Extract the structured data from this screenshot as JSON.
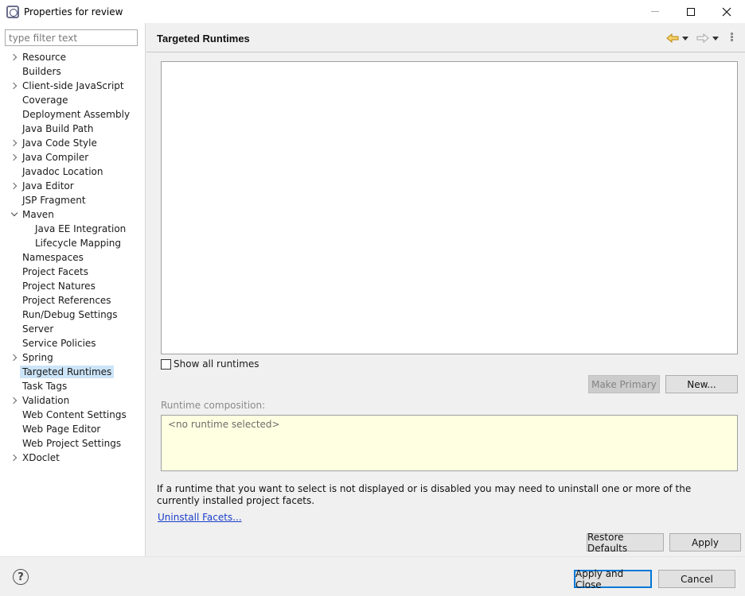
{
  "window": {
    "title": "Properties for review",
    "app_icon": "eclipse-icon"
  },
  "filter": {
    "placeholder": "type filter text",
    "value": ""
  },
  "tree": [
    {
      "label": "Resource",
      "expander": "collapsed",
      "level": 0
    },
    {
      "label": "Builders",
      "expander": "none",
      "level": 0
    },
    {
      "label": "Client-side JavaScript",
      "expander": "collapsed",
      "level": 0
    },
    {
      "label": "Coverage",
      "expander": "none",
      "level": 0
    },
    {
      "label": "Deployment Assembly",
      "expander": "none",
      "level": 0
    },
    {
      "label": "Java Build Path",
      "expander": "none",
      "level": 0
    },
    {
      "label": "Java Code Style",
      "expander": "collapsed",
      "level": 0
    },
    {
      "label": "Java Compiler",
      "expander": "collapsed",
      "level": 0
    },
    {
      "label": "Javadoc Location",
      "expander": "none",
      "level": 0
    },
    {
      "label": "Java Editor",
      "expander": "collapsed",
      "level": 0
    },
    {
      "label": "JSP Fragment",
      "expander": "none",
      "level": 0
    },
    {
      "label": "Maven",
      "expander": "expanded",
      "level": 0
    },
    {
      "label": "Java EE Integration",
      "expander": "none",
      "level": 1
    },
    {
      "label": "Lifecycle Mapping",
      "expander": "none",
      "level": 1
    },
    {
      "label": "Namespaces",
      "expander": "none",
      "level": 0
    },
    {
      "label": "Project Facets",
      "expander": "none",
      "level": 0
    },
    {
      "label": "Project Natures",
      "expander": "none",
      "level": 0
    },
    {
      "label": "Project References",
      "expander": "none",
      "level": 0
    },
    {
      "label": "Run/Debug Settings",
      "expander": "none",
      "level": 0
    },
    {
      "label": "Server",
      "expander": "none",
      "level": 0
    },
    {
      "label": "Service Policies",
      "expander": "none",
      "level": 0
    },
    {
      "label": "Spring",
      "expander": "collapsed",
      "level": 0
    },
    {
      "label": "Targeted Runtimes",
      "expander": "none",
      "level": 0,
      "selected": true
    },
    {
      "label": "Task Tags",
      "expander": "none",
      "level": 0
    },
    {
      "label": "Validation",
      "expander": "collapsed",
      "level": 0
    },
    {
      "label": "Web Content Settings",
      "expander": "none",
      "level": 0
    },
    {
      "label": "Web Page Editor",
      "expander": "none",
      "level": 0
    },
    {
      "label": "Web Project Settings",
      "expander": "none",
      "level": 0
    },
    {
      "label": "XDoclet",
      "expander": "collapsed",
      "level": 0
    }
  ],
  "page": {
    "title": "Targeted Runtimes",
    "show_all_runtimes": "Show all runtimes",
    "show_all_checked": false,
    "make_primary": "Make Primary",
    "new": "New...",
    "runtime_composition_label": "Runtime composition:",
    "runtime_composition_value": "<no runtime selected>",
    "info": "If a runtime that you want to select is not displayed or is disabled you may need to uninstall one or more of the currently installed project facets.",
    "uninstall_link": "Uninstall Facets...",
    "restore_defaults": "Restore Defaults",
    "apply": "Apply"
  },
  "footer": {
    "apply_close": "Apply and Close",
    "cancel": "Cancel",
    "help_icon": "help-icon"
  },
  "colors": {
    "selection": "#cce4f7",
    "composition_bg": "#ffffe1",
    "link": "#1a3ec9",
    "default_button_border": "#0078d7",
    "nav_back_arrow": "#e0a21a"
  }
}
